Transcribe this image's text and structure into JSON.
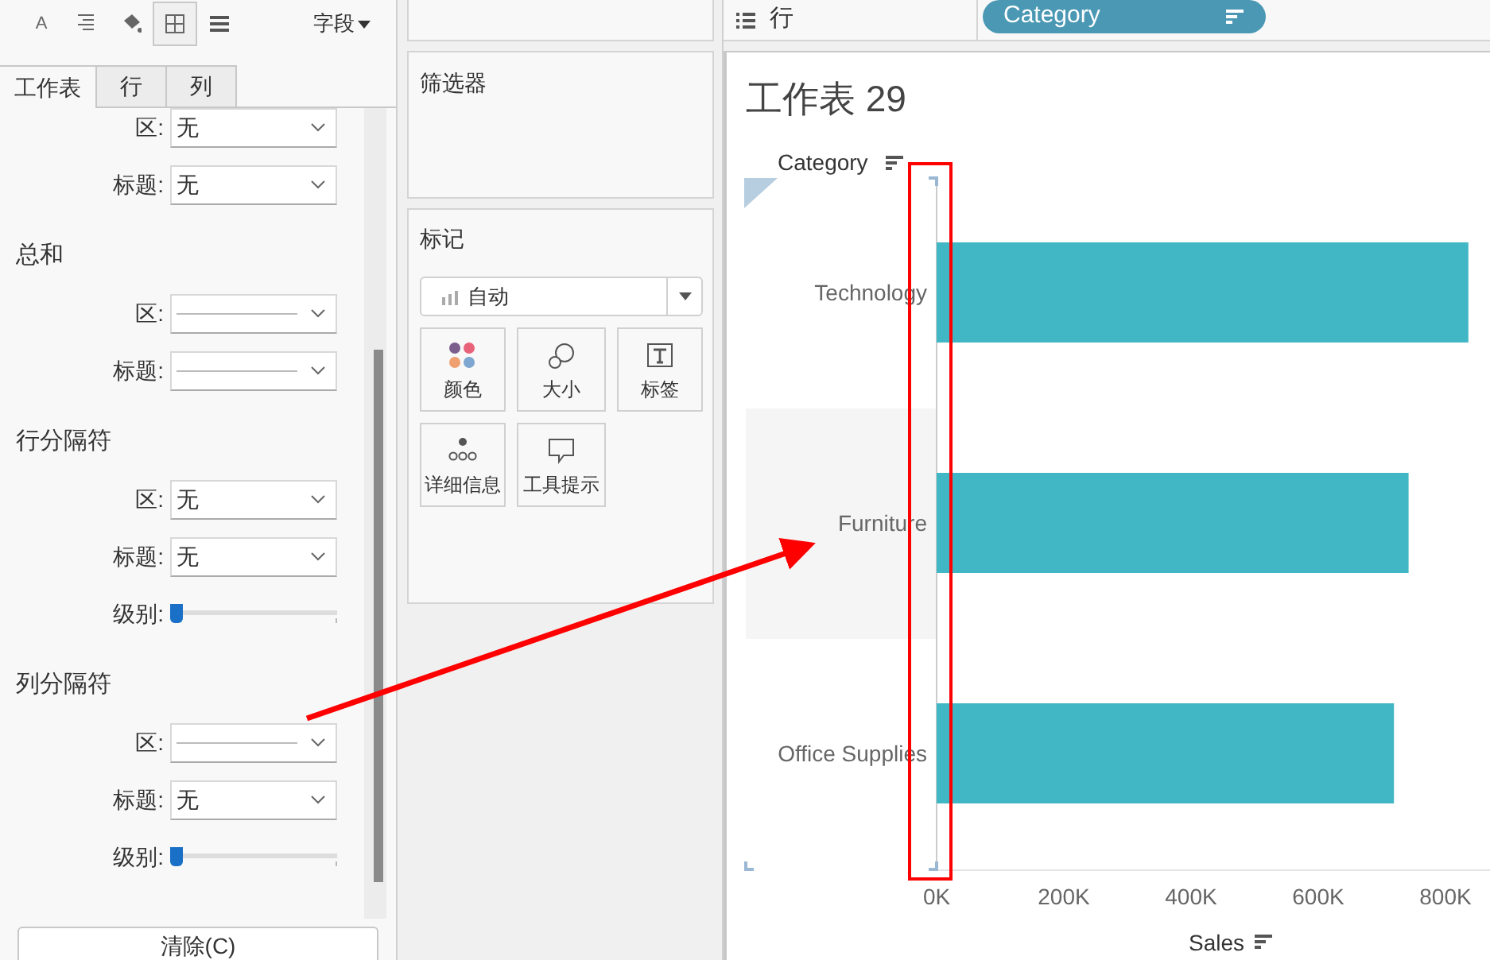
{
  "toolbar": {
    "buttons": [
      {
        "kind": "font",
        "glyph": "A",
        "selected": false
      },
      {
        "kind": "align",
        "selected": false
      },
      {
        "kind": "shading",
        "selected": false
      },
      {
        "kind": "borders",
        "selected": true
      },
      {
        "kind": "lines",
        "selected": false
      }
    ],
    "menu": "字段"
  },
  "tabs": [
    {
      "label": "工作表",
      "selected": true
    },
    {
      "label": "行",
      "selected": false
    },
    {
      "label": "列",
      "selected": false
    }
  ],
  "format_sections": [
    {
      "fields": [
        {
          "label": "区:",
          "kind": "select",
          "value": "无"
        },
        {
          "label": "标题:",
          "kind": "select",
          "value": "无"
        }
      ]
    },
    {
      "heading": "总和",
      "fields": [
        {
          "label": "区:",
          "kind": "line_select"
        },
        {
          "label": "标题:",
          "kind": "line_select"
        }
      ]
    },
    {
      "heading": "行分隔符",
      "fields": [
        {
          "label": "区:",
          "kind": "select",
          "value": "无"
        },
        {
          "label": "标题:",
          "kind": "select",
          "value": "无"
        },
        {
          "label": "级别:",
          "kind": "slider",
          "level": 0
        }
      ]
    },
    {
      "heading": "列分隔符",
      "fields": [
        {
          "label": "区:",
          "kind": "line_select"
        },
        {
          "label": "标题:",
          "kind": "select",
          "value": "无"
        },
        {
          "label": "级别:",
          "kind": "slider",
          "level": 0
        }
      ]
    }
  ],
  "clear_button": "清除(C)",
  "filters_card": {
    "title": "筛选器"
  },
  "marks_card": {
    "title": "标记",
    "mark_type": "自动",
    "buttons": [
      {
        "kind": "color",
        "label": "颜色"
      },
      {
        "kind": "size",
        "label": "大小"
      },
      {
        "kind": "label",
        "label": "标签"
      },
      {
        "kind": "detail",
        "label": "详细信息"
      },
      {
        "kind": "tooltip",
        "label": "工具提示"
      }
    ]
  },
  "rows_shelf": {
    "label": "行",
    "pills": [
      {
        "label": "Category"
      }
    ]
  },
  "worksheet": {
    "title": "工作表 29",
    "chart_data": {
      "type": "bar",
      "orientation": "horizontal",
      "xlabel": "Sales",
      "ylabel": "Category",
      "categories": [
        "Technology",
        "Furniture",
        "Office Supplies"
      ],
      "series": [
        {
          "color": "#41b6c4",
          "values": [
            836000,
            742000,
            719000
          ]
        }
      ],
      "xlim": [
        0,
        870000
      ],
      "xticks": [
        {
          "value": 0,
          "label": "0K"
        },
        {
          "value": 200000,
          "label": "200K"
        },
        {
          "value": 400000,
          "label": "400K"
        },
        {
          "value": 600000,
          "label": "600K"
        },
        {
          "value": 800000,
          "label": "800K"
        }
      ]
    }
  }
}
